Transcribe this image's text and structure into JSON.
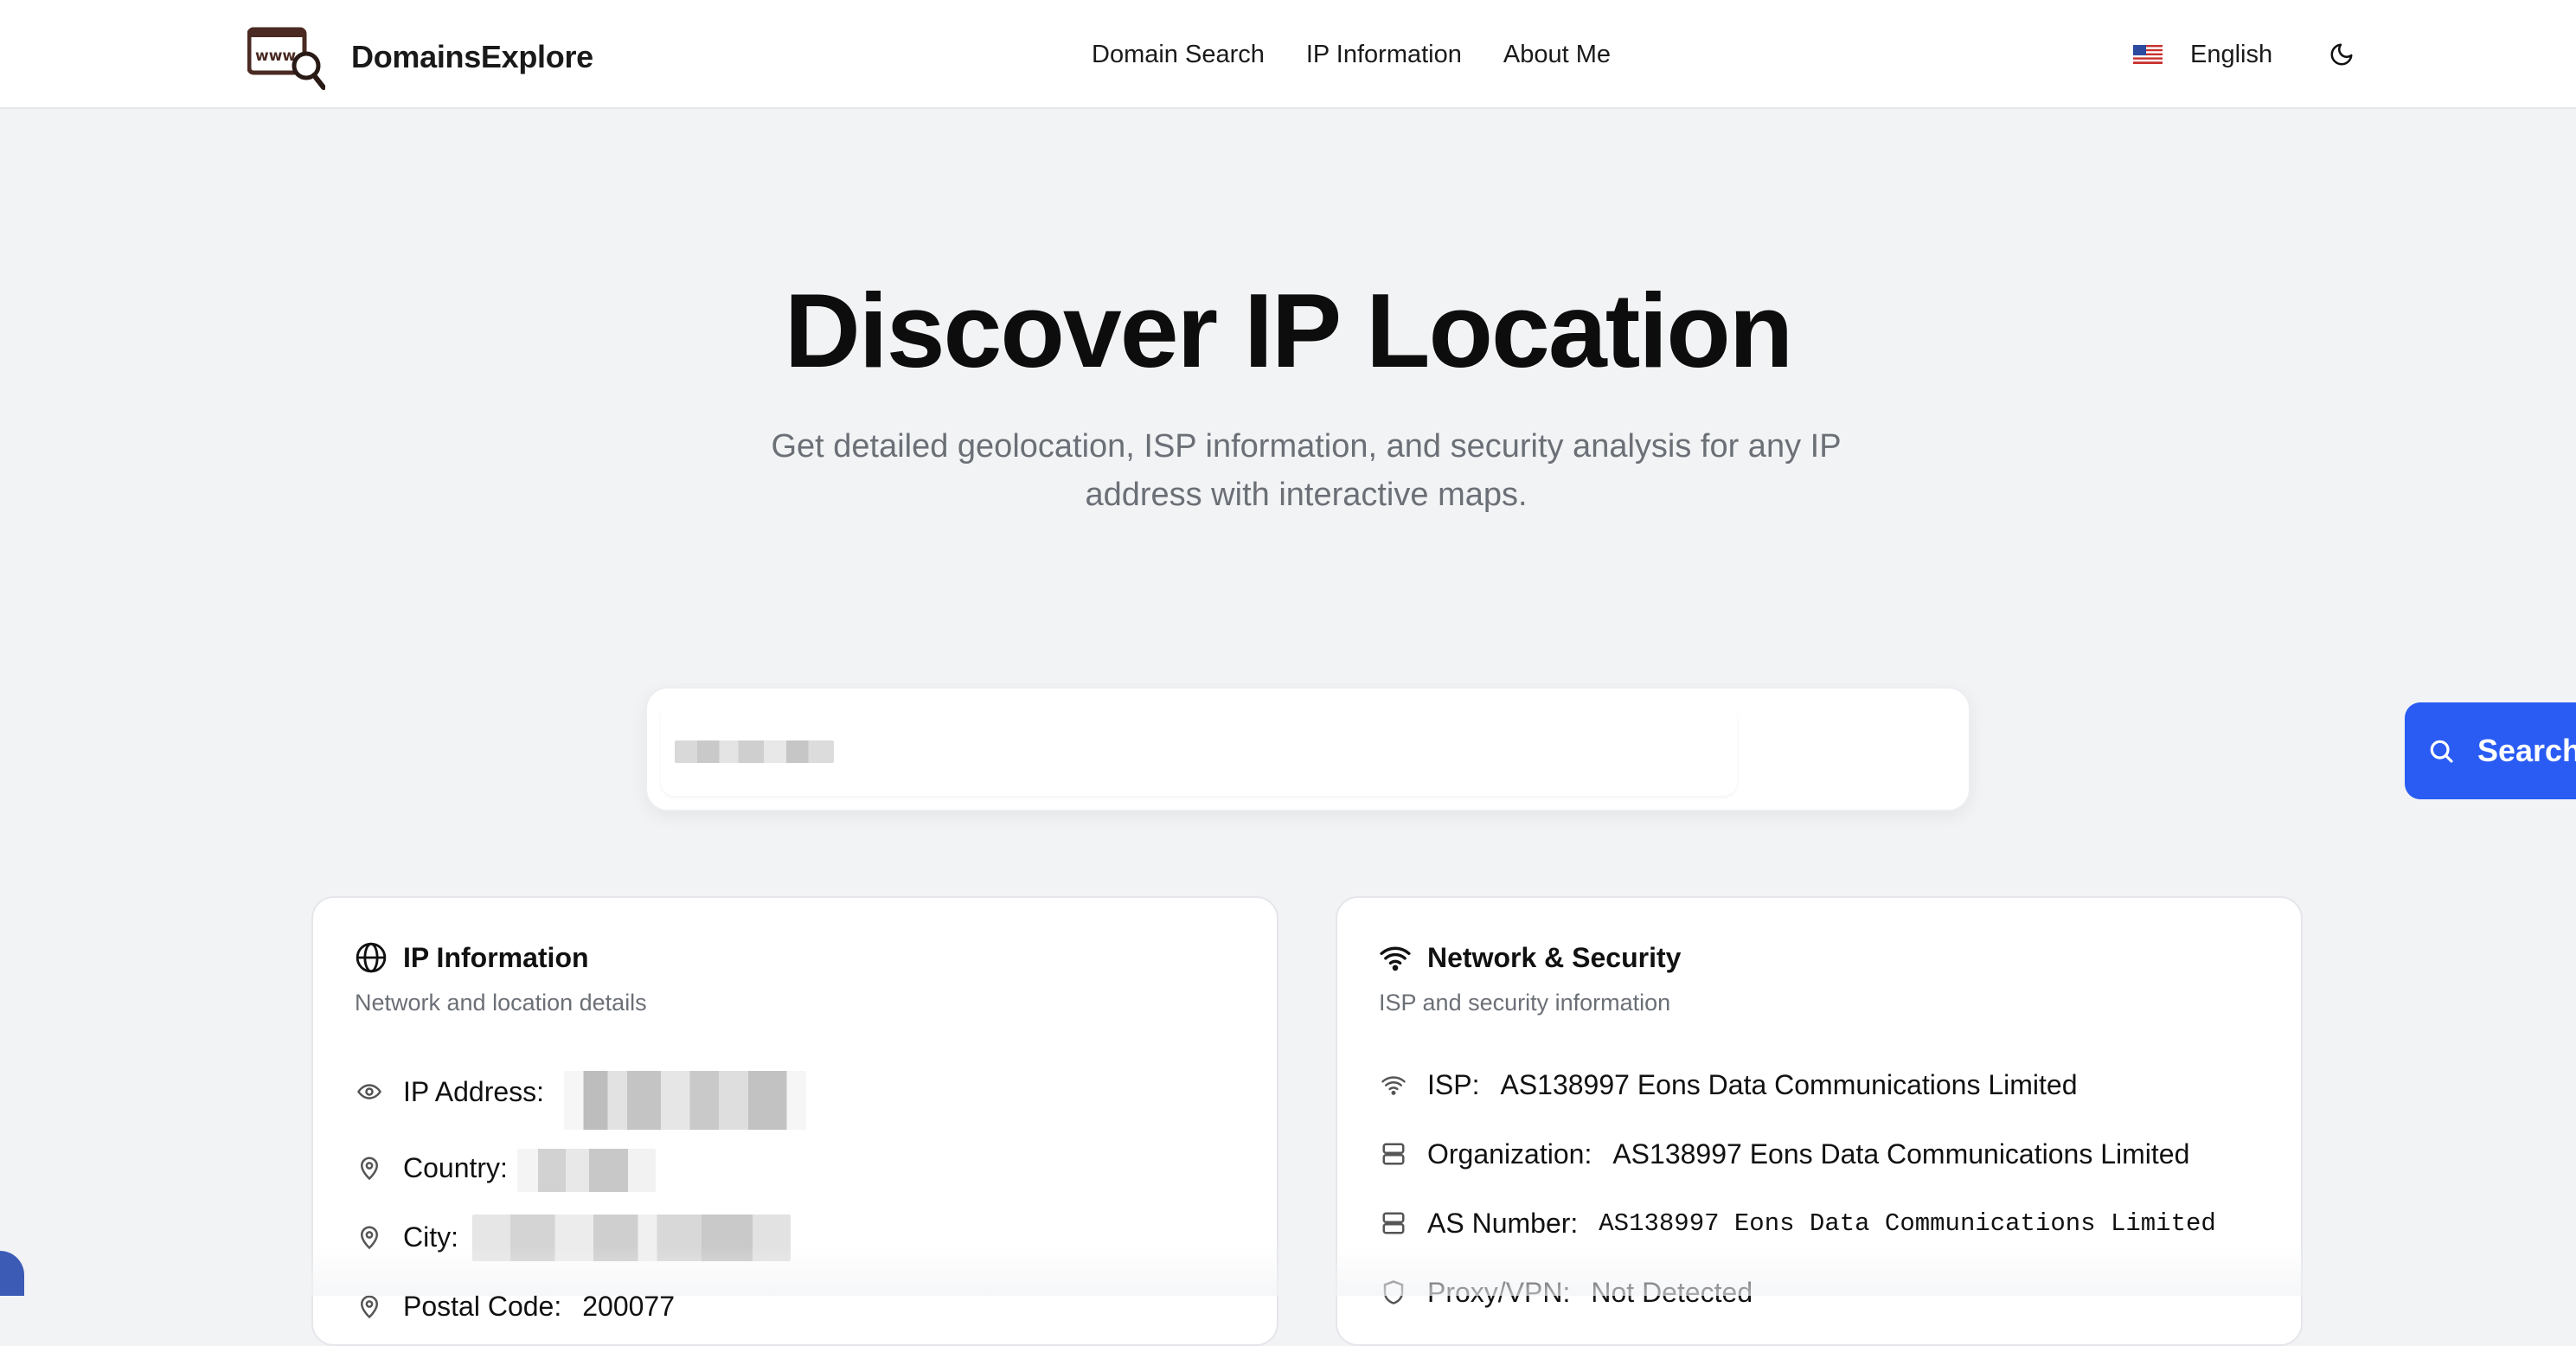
{
  "brand": {
    "name": "DomainsExplore",
    "logo_text": "www"
  },
  "nav": {
    "links": [
      "Domain Search",
      "IP Information",
      "About Me"
    ]
  },
  "language": {
    "flag": "us-flag-icon",
    "label": "English"
  },
  "theme_toggle": {
    "icon": "moon-icon"
  },
  "hero": {
    "title": "Discover IP Location",
    "subtitle": "Get detailed geolocation, ISP information, and security analysis for any IP address with interactive maps."
  },
  "search": {
    "value": "",
    "button_label": "Search",
    "button_icon": "search-icon",
    "accent": "#2a5cf4"
  },
  "ip_card": {
    "title": "IP Information",
    "description": "Network and location details",
    "rows": [
      {
        "label": "IP Address:",
        "value": "",
        "icon": "eye-icon"
      },
      {
        "label": "Country:",
        "value": "",
        "icon": "map-pin-icon"
      },
      {
        "label": "City:",
        "value": "",
        "icon": "map-pin-icon"
      },
      {
        "label": "Postal Code:",
        "value": "200077",
        "icon": "map-pin-icon"
      }
    ]
  },
  "network_card": {
    "title": "Network & Security",
    "description": "ISP and security information",
    "rows": [
      {
        "label": "ISP:",
        "value": "AS138997 Eons Data Communications Limited",
        "icon": "wifi-icon"
      },
      {
        "label": "Organization:",
        "value": "AS138997 Eons Data Communications Limited",
        "icon": "server-icon"
      },
      {
        "label": "AS Number:",
        "value": "AS138997 Eons Data Communications Limited",
        "icon": "server-icon"
      },
      {
        "label": "Proxy/VPN:",
        "value": "Not Detected",
        "icon": "shield-icon"
      }
    ]
  }
}
